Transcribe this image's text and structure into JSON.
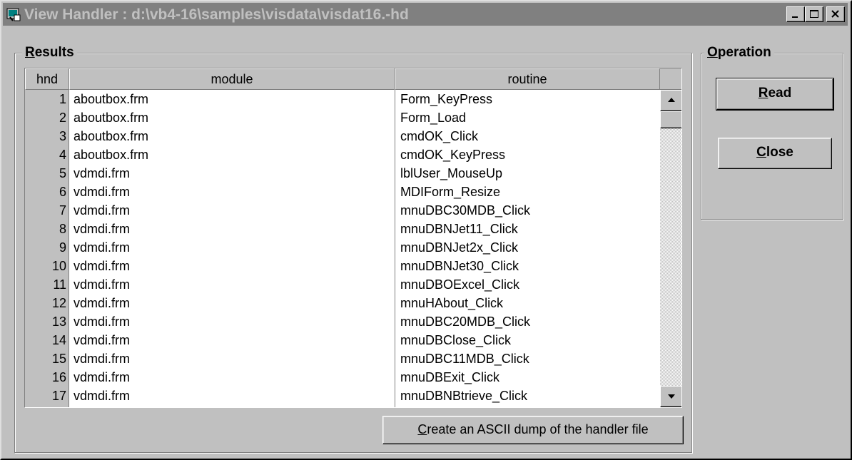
{
  "window": {
    "title": "View Handler : d:\\vb4-16\\samples\\visdata\\visdat16.-hd"
  },
  "results": {
    "group_label_underlined": "R",
    "group_label_rest": "esults",
    "columns": [
      "hnd",
      "module",
      "routine"
    ],
    "rows": [
      {
        "hnd": "1",
        "module": "aboutbox.frm",
        "routine": "Form_KeyPress"
      },
      {
        "hnd": "2",
        "module": "aboutbox.frm",
        "routine": "Form_Load"
      },
      {
        "hnd": "3",
        "module": "aboutbox.frm",
        "routine": "cmdOK_Click"
      },
      {
        "hnd": "4",
        "module": "aboutbox.frm",
        "routine": "cmdOK_KeyPress"
      },
      {
        "hnd": "5",
        "module": "vdmdi.frm",
        "routine": "lblUser_MouseUp"
      },
      {
        "hnd": "6",
        "module": "vdmdi.frm",
        "routine": "MDIForm_Resize"
      },
      {
        "hnd": "7",
        "module": "vdmdi.frm",
        "routine": "mnuDBC30MDB_Click"
      },
      {
        "hnd": "8",
        "module": "vdmdi.frm",
        "routine": "mnuDBNJet11_Click"
      },
      {
        "hnd": "9",
        "module": "vdmdi.frm",
        "routine": "mnuDBNJet2x_Click"
      },
      {
        "hnd": "10",
        "module": "vdmdi.frm",
        "routine": "mnuDBNJet30_Click"
      },
      {
        "hnd": "11",
        "module": "vdmdi.frm",
        "routine": "mnuDBOExcel_Click"
      },
      {
        "hnd": "12",
        "module": "vdmdi.frm",
        "routine": "mnuHAbout_Click"
      },
      {
        "hnd": "13",
        "module": "vdmdi.frm",
        "routine": "mnuDBC20MDB_Click"
      },
      {
        "hnd": "14",
        "module": "vdmdi.frm",
        "routine": "mnuDBClose_Click"
      },
      {
        "hnd": "15",
        "module": "vdmdi.frm",
        "routine": "mnuDBC11MDB_Click"
      },
      {
        "hnd": "16",
        "module": "vdmdi.frm",
        "routine": "mnuDBExit_Click"
      },
      {
        "hnd": "17",
        "module": "vdmdi.frm",
        "routine": "mnuDBNBtrieve_Click"
      }
    ],
    "dump_button_underlined": "C",
    "dump_button_rest": "reate an ASCII dump of the handler file"
  },
  "operation": {
    "group_label_underlined": "O",
    "group_label_rest": "peration",
    "read_underlined": "R",
    "read_rest": "ead",
    "close_underlined": "C",
    "close_rest": "lose"
  }
}
